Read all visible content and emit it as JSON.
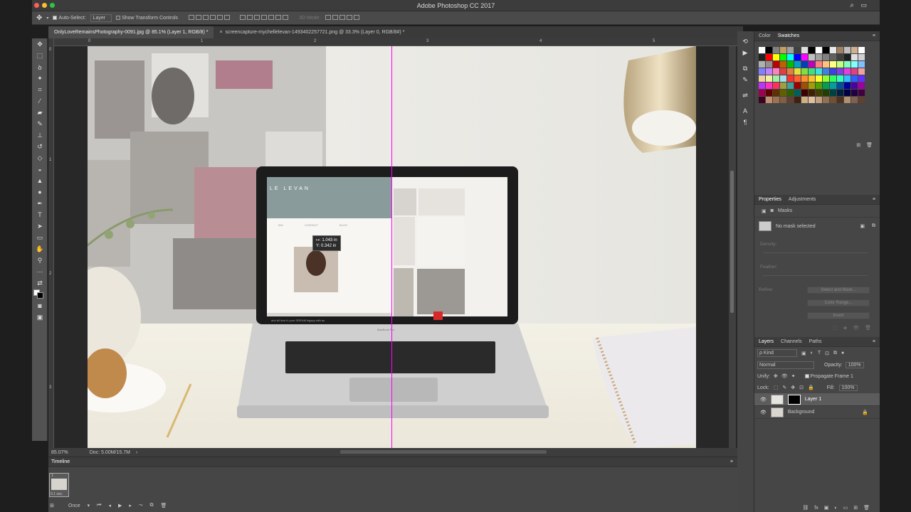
{
  "app": {
    "title": "Adobe Photoshop CC 2017",
    "colors": {
      "accent": "#ff00ff",
      "ui_bg": "#464646",
      "canvas_bg": "#282828"
    }
  },
  "options_bar": {
    "auto_select_label": "Auto-Select:",
    "auto_select_value": "Layer",
    "show_transform_label": "Show Transform Controls",
    "mode_3d_label": "3D Mode:"
  },
  "tabs": [
    {
      "label": "OnlyLoveRemainsPhotography-0091.jpg @ 85.1% (Layer 1, RGB/8) *",
      "active": true
    },
    {
      "label": "screencapture-mychellelevan-1493402257721.png @ 33.3% (Layer 0, RGB/8#) *",
      "active": false
    }
  ],
  "tab_close_icon": "×",
  "rulers": {
    "h": [
      "0",
      "1",
      "2",
      "3",
      "4",
      "5"
    ],
    "v": [
      "0",
      "1",
      "2",
      "3"
    ]
  },
  "canvas": {
    "tooltip_x": "↦: 1.043 in",
    "tooltip_y": "Y: 0.342 in",
    "laptop_brand": "MacBook Pro",
    "site_logo": "LE LEVAN",
    "site_nav": [
      "BIO",
      "CONTACT",
      "BLOG"
    ],
    "site_footer": "and all love in your DREAM legacy with as"
  },
  "status": {
    "zoom": "85.07%",
    "doc": "Doc: 5.00M/15.7M"
  },
  "timeline": {
    "title": "Timeline",
    "frame_number": "1",
    "frame_delay": "0.1 sec.",
    "loop": "Once"
  },
  "color_panel": {
    "tabs": [
      "Color",
      "Swatches"
    ],
    "swatches": [
      "#ffffff",
      "#000000",
      "#808080",
      "#c0a060",
      "#a0a0a0",
      "#404040",
      "#e0e0e0",
      "#000000",
      "#ffffff",
      "#000000",
      "#e8e8e8",
      "#a08060",
      "#c0c0c0",
      "#d0b090",
      "#ffffff",
      "#202020",
      "#ff0000",
      "#ffff00",
      "#00ff00",
      "#00ffff",
      "#0000ff",
      "#ff00ff",
      "#c0c0c0",
      "#a0a0a0",
      "#808080",
      "#606060",
      "#404040",
      "#202020",
      "#e0e0e0",
      "#d0d0d0",
      "#b0b0b0",
      "#909090",
      "#c00000",
      "#c06000",
      "#00c000",
      "#00a0c0",
      "#0040c0",
      "#c000c0",
      "#ff8080",
      "#ffc080",
      "#ffff80",
      "#c0ff80",
      "#80ffc0",
      "#80ffff",
      "#80c0ff",
      "#8080ff",
      "#c080ff",
      "#ff80c0",
      "#e04040",
      "#e08040",
      "#e0e040",
      "#80e040",
      "#40e080",
      "#40e0e0",
      "#4080e0",
      "#4040e0",
      "#8040e0",
      "#e040e0",
      "#e04080",
      "#f0a0a0",
      "#f0d0a0",
      "#f0f0a0",
      "#a0f0a0",
      "#a0e0f0",
      "#ff3030",
      "#ff6030",
      "#ff9030",
      "#ffc030",
      "#ffff30",
      "#90ff30",
      "#30ff60",
      "#30ffc0",
      "#30c0ff",
      "#3060ff",
      "#6030ff",
      "#c030ff",
      "#ff30c0",
      "#ff3060",
      "#a0a040",
      "#40a0a0",
      "#a00000",
      "#a05000",
      "#a0a000",
      "#50a000",
      "#00a050",
      "#00a0a0",
      "#0050a0",
      "#0000a0",
      "#5000a0",
      "#a000a0",
      "#a00050",
      "#600000",
      "#603000",
      "#606000",
      "#306000",
      "#006060",
      "#400000",
      "#402000",
      "#404000",
      "#204000",
      "#004040",
      "#002040",
      "#000040",
      "#200040",
      "#400040",
      "#400020",
      "#c09070",
      "#a07050",
      "#806040",
      "#604030",
      "#402010",
      "#d0b080",
      "#e0c0a0",
      "#c0a080",
      "#907050",
      "#705030",
      "#503020",
      "#b09070",
      "#806050",
      "#604030"
    ],
    "icons": [
      "new-swatch-icon",
      "trash-icon"
    ]
  },
  "properties_panel": {
    "tabs": [
      "Properties",
      "Adjustments"
    ],
    "section": "Masks",
    "no_mask": "No mask selected",
    "density": "Density:",
    "feather": "Feather:",
    "refine": "Refine:",
    "select_mask": "Select and Mask...",
    "color_range": "Color Range...",
    "invert": "Invert"
  },
  "layers_panel": {
    "tabs": [
      "Layers",
      "Channels",
      "Paths"
    ],
    "kind": "ρ Kind",
    "blend_mode": "Normal",
    "opacity_label": "Opacity:",
    "opacity": "100%",
    "unify_label": "Unify:",
    "propagate": "Propagate Frame 1",
    "lock_label": "Lock:",
    "fill_label": "Fill:",
    "fill": "100%",
    "layers": [
      {
        "name": "Layer 1",
        "selected": true
      },
      {
        "name": "Background",
        "selected": false
      }
    ]
  }
}
